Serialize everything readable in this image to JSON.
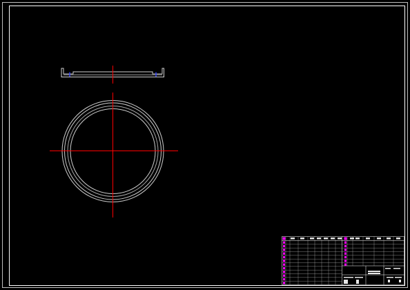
{
  "drawing": {
    "background": "#000000",
    "line_color": "#ffffff",
    "outline_color": "#cfcfcf",
    "centerline_color": "#ff0000",
    "hidden_line_color": "#2b3cff",
    "highlight_color": "#ff00ff"
  },
  "title_block": {
    "row_count": 12,
    "note_text": ""
  }
}
